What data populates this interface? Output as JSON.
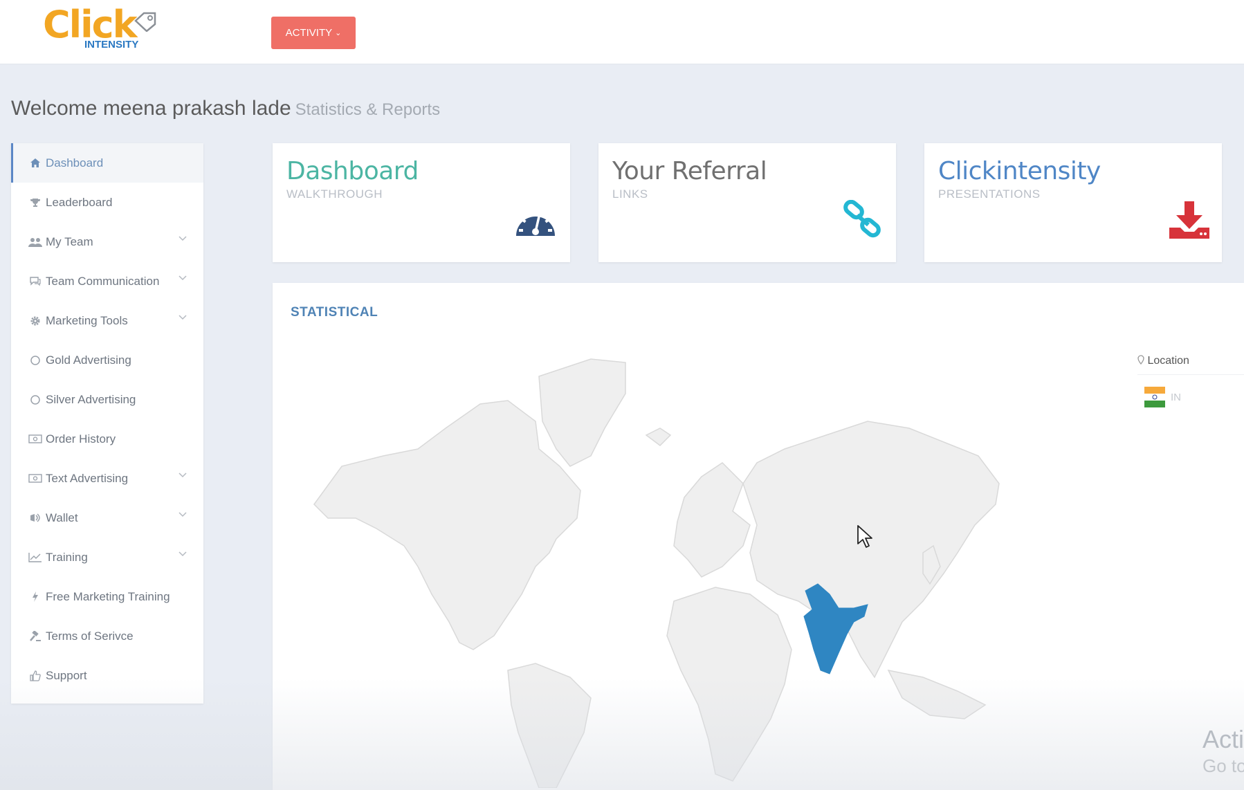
{
  "header": {
    "logo": {
      "word": "Click",
      "sub": "INTENSITY"
    },
    "activity_label": "ACTIVITY"
  },
  "welcome": {
    "text": "Welcome meena prakash lade",
    "subtitle": "Statistics & Reports"
  },
  "sidebar": {
    "items": [
      {
        "label": "Dashboard",
        "icon": "home-icon",
        "active": true,
        "has_submenu": false
      },
      {
        "label": "Leaderboard",
        "icon": "trophy-icon",
        "has_submenu": false
      },
      {
        "label": "My Team",
        "icon": "users-icon",
        "has_submenu": true
      },
      {
        "label": "Team Communication",
        "icon": "chat-icon",
        "has_submenu": true
      },
      {
        "label": "Marketing Tools",
        "icon": "gear-icon",
        "has_submenu": true
      },
      {
        "label": "Gold Advertising",
        "icon": "circle-icon",
        "has_submenu": false
      },
      {
        "label": "Silver Advertising",
        "icon": "circle-icon",
        "has_submenu": false
      },
      {
        "label": "Order History",
        "icon": "money-icon",
        "has_submenu": false
      },
      {
        "label": "Text Advertising",
        "icon": "money-icon",
        "has_submenu": true
      },
      {
        "label": "Wallet",
        "icon": "wallet-icon",
        "has_submenu": true
      },
      {
        "label": "Training",
        "icon": "chart-icon",
        "has_submenu": true
      },
      {
        "label": "Free Marketing Training",
        "icon": "bolt-icon",
        "has_submenu": false
      },
      {
        "label": "Terms of Serivce",
        "icon": "gavel-icon",
        "has_submenu": false
      },
      {
        "label": "Support",
        "icon": "thumbs-up-icon",
        "has_submenu": false
      }
    ]
  },
  "cards": [
    {
      "title": "Dashboard",
      "subtitle": "WALKTHROUGH",
      "color": "#4cb5a3",
      "icon": "speedometer-icon",
      "icon_color": "#34527e"
    },
    {
      "title": "Your Referral",
      "subtitle": "LINKS",
      "color": "#707070",
      "icon": "link-icon",
      "icon_color": "#23b7d3"
    },
    {
      "title": "Clickintensity",
      "subtitle": "PRESENTATIONS",
      "color": "#4f86c6",
      "icon": "download-icon",
      "icon_color": "#d7333a"
    }
  ],
  "statistical": {
    "title": "STATISTICAL",
    "location_header": "Location",
    "locations": [
      {
        "code": "IN"
      }
    ],
    "highlight_color": "#2f86c2"
  },
  "watermark": {
    "line1": "Acti",
    "line2": "Go to"
  }
}
